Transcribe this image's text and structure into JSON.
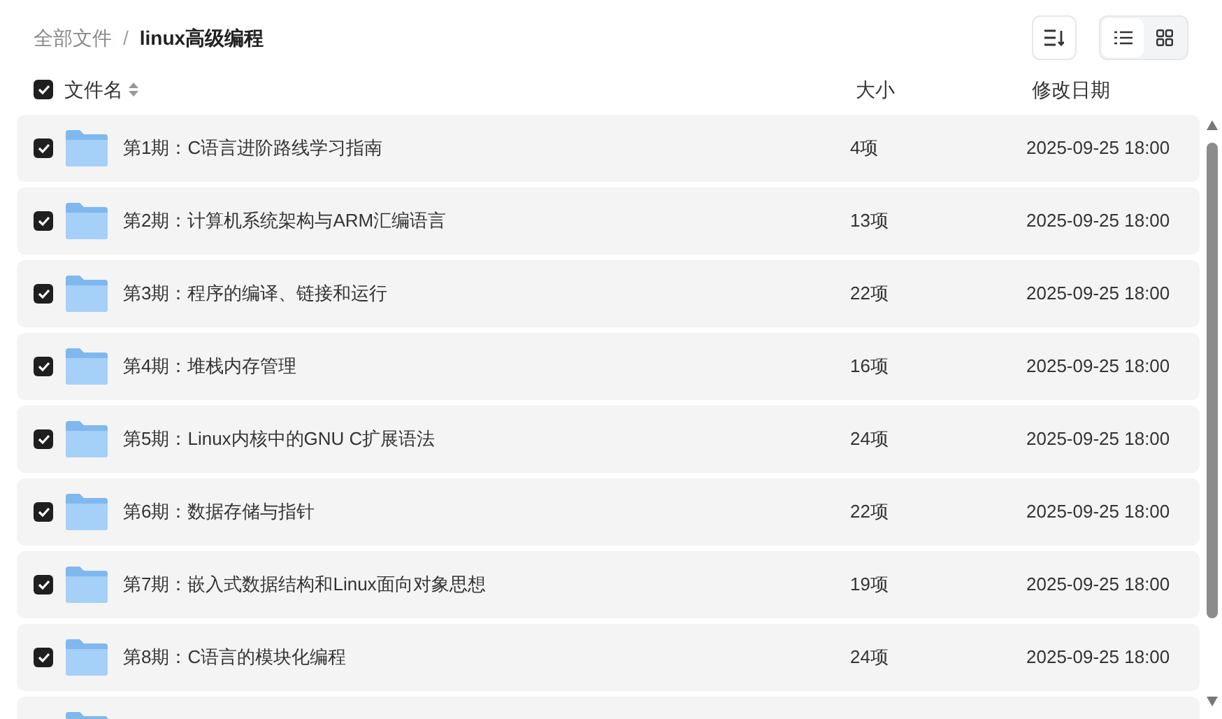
{
  "breadcrumb_separator": "/",
  "breadcrumb": [
    {
      "label": "全部文件",
      "current": false
    },
    {
      "label": "linux高级编程",
      "current": true
    }
  ],
  "view_toggle": [
    {
      "kind": "list",
      "selected": true
    },
    {
      "kind": "grid",
      "selected": false
    }
  ],
  "header": {
    "checked": true,
    "name": "文件名",
    "size": "大小",
    "date": "修改日期"
  },
  "rows": [
    {
      "checked": true,
      "name": "第1期：C语言进阶路线学习指南",
      "size": "4项",
      "date": "2025-09-25 18:00"
    },
    {
      "checked": true,
      "name": "第2期：计算机系统架构与ARM汇编语言",
      "size": "13项",
      "date": "2025-09-25 18:00"
    },
    {
      "checked": true,
      "name": "第3期：程序的编译、链接和运行",
      "size": "22项",
      "date": "2025-09-25 18:00"
    },
    {
      "checked": true,
      "name": "第4期：堆栈内存管理",
      "size": "16项",
      "date": "2025-09-25 18:00"
    },
    {
      "checked": true,
      "name": "第5期：Linux内核中的GNU C扩展语法",
      "size": "24项",
      "date": "2025-09-25 18:00"
    },
    {
      "checked": true,
      "name": "第6期：数据存储与指针",
      "size": "22项",
      "date": "2025-09-25 18:00"
    },
    {
      "checked": true,
      "name": "第7期：嵌入式数据结构和Linux面向对象思想",
      "size": "19项",
      "date": "2025-09-25 18:00"
    },
    {
      "checked": true,
      "name": "第8期：C语言的模块化编程",
      "size": "24项",
      "date": "2025-09-25 18:00"
    },
    {}
  ]
}
